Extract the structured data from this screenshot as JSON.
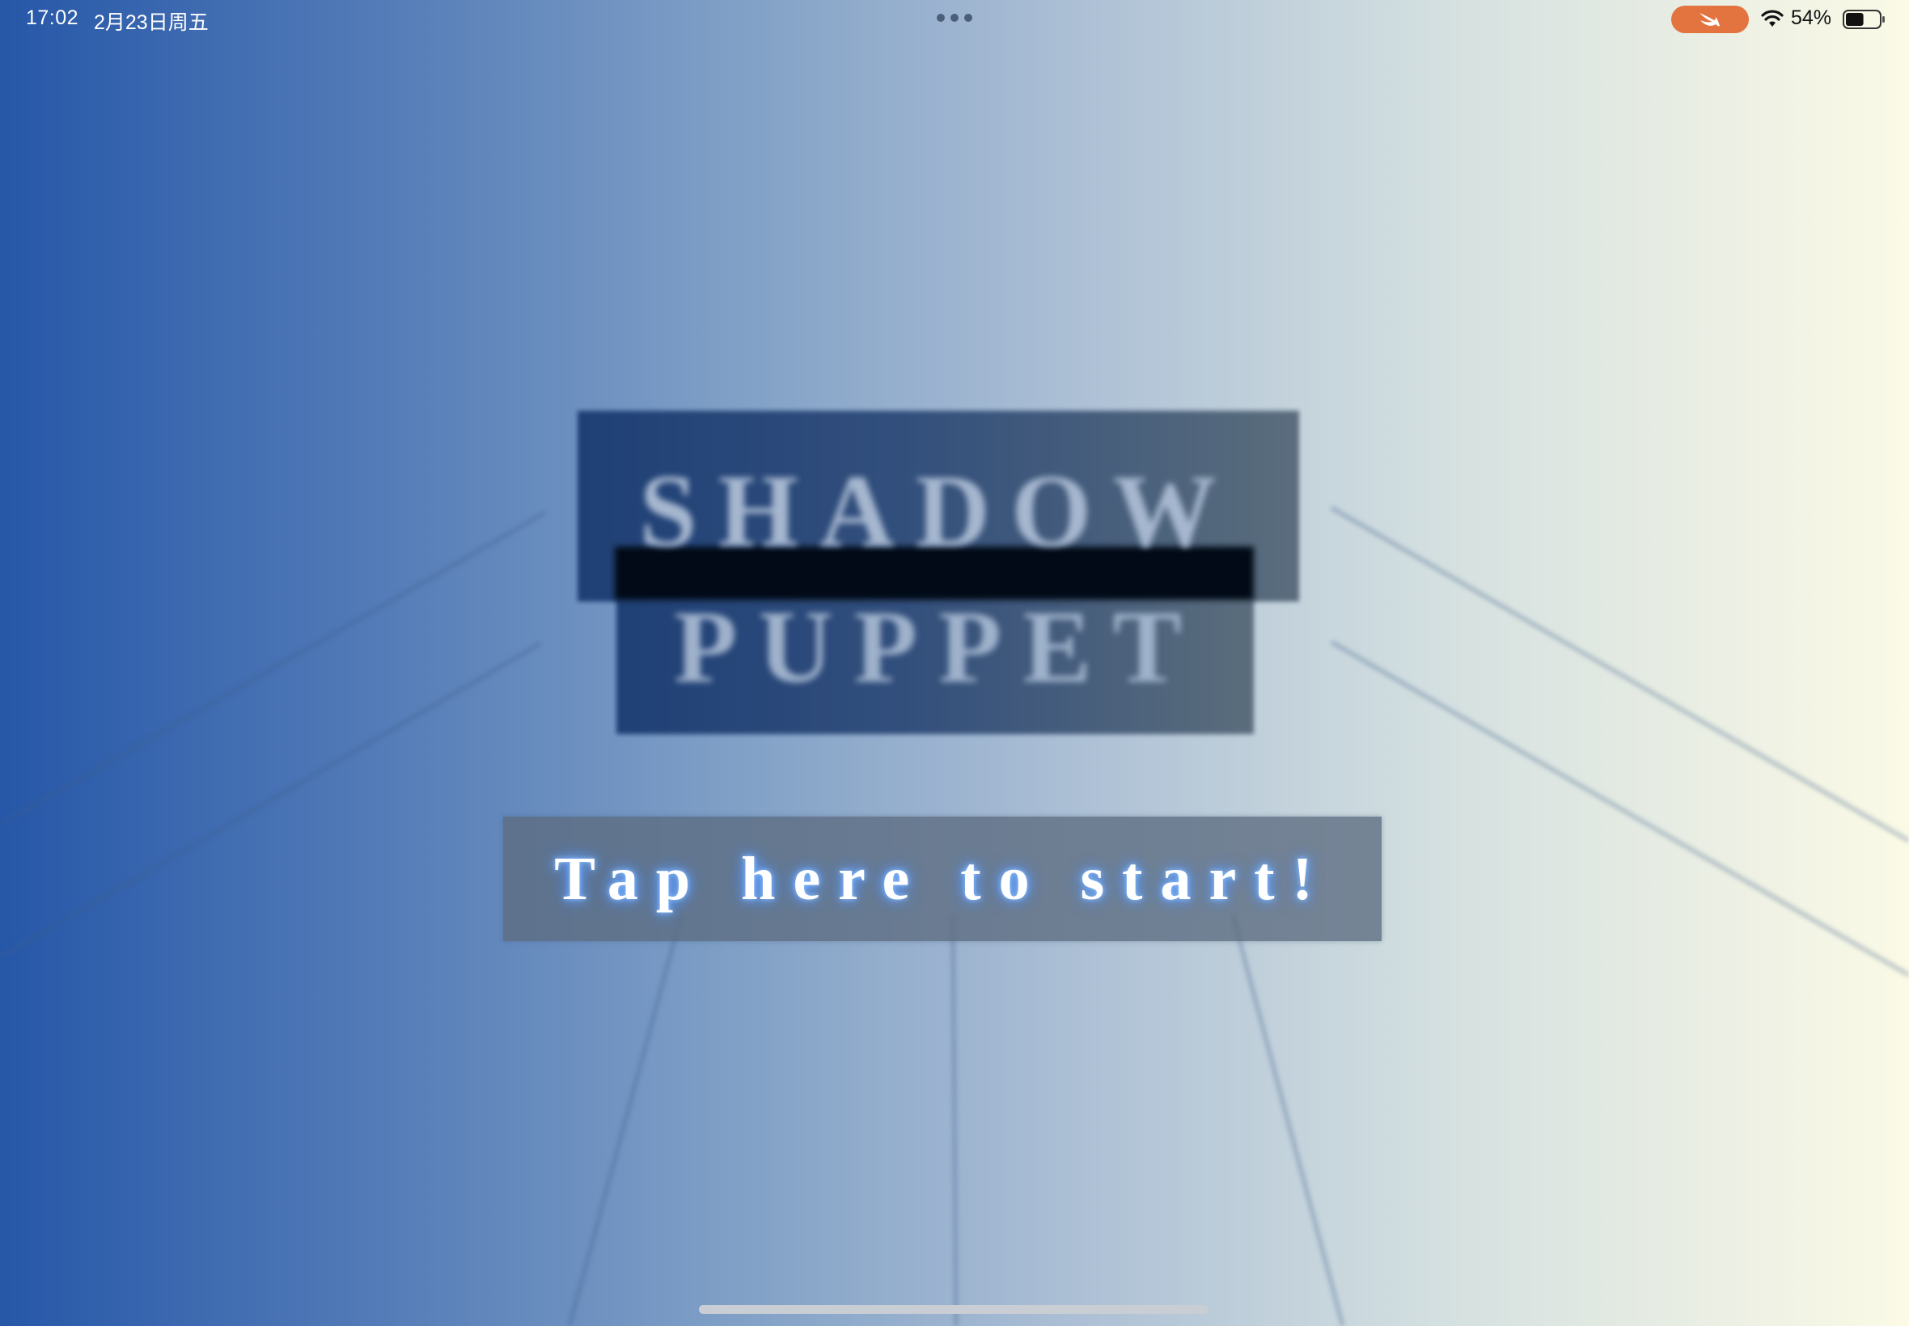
{
  "status_bar": {
    "time": "17:02",
    "date": "2月23日周五",
    "battery_percent": "54%",
    "battery_level": 0.54,
    "icons": [
      "multitask-dots-icon",
      "swift-icon",
      "wifi-icon",
      "battery-icon"
    ]
  },
  "game": {
    "title_line_1": "SHADOW",
    "title_line_2": "PUPPET",
    "start_label": "Tap here to start!"
  },
  "colors": {
    "background_left": "#2657a8",
    "background_right": "#fbfae6",
    "title_box": "#1b3c72",
    "swift_pill": "#e3733f",
    "start_glow": "#3f86ff"
  }
}
